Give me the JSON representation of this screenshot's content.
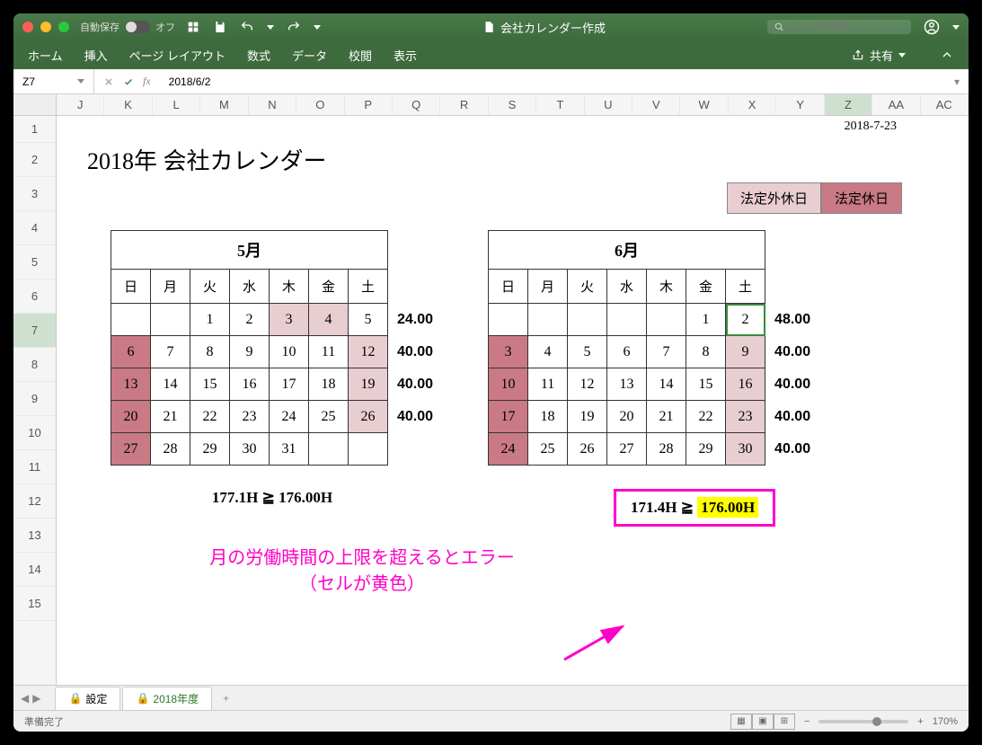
{
  "titlebar": {
    "autosave_label": "自動保存",
    "autosave_state": "オフ",
    "doc_title": "会社カレンダー作成",
    "search_placeholder": "シートを検索"
  },
  "ribbon": {
    "tabs": [
      "ホーム",
      "挿入",
      "ページ レイアウト",
      "数式",
      "データ",
      "校閲",
      "表示"
    ],
    "share": "共有"
  },
  "formula_bar": {
    "cell_ref": "Z7",
    "formula": "2018/6/2"
  },
  "columns": [
    "J",
    "K",
    "L",
    "M",
    "N",
    "O",
    "P",
    "Q",
    "R",
    "S",
    "T",
    "U",
    "V",
    "W",
    "X",
    "Y",
    "Z",
    "AA",
    "AC"
  ],
  "active_col": "Z",
  "rows": [
    1,
    2,
    3,
    4,
    5,
    6,
    7,
    8,
    9,
    10,
    11,
    12,
    13,
    14,
    15
  ],
  "active_row": 7,
  "sheet": {
    "date": "2018-7-23",
    "title": "2018年 会社カレンダー",
    "legend": {
      "a": "法定外休日",
      "b": "法定休日"
    },
    "calendars": [
      {
        "month": "5月",
        "dow": [
          "日",
          "月",
          "火",
          "水",
          "木",
          "金",
          "土"
        ],
        "weeks": [
          {
            "days": [
              {},
              {},
              {
                "n": 1
              },
              {
                "n": 2
              },
              {
                "n": 3,
                "cls": "hol-a"
              },
              {
                "n": 4,
                "cls": "hol-a"
              },
              {
                "n": 5
              }
            ],
            "h": "24.00"
          },
          {
            "days": [
              {
                "n": 6,
                "cls": "hol-b"
              },
              {
                "n": 7
              },
              {
                "n": 8
              },
              {
                "n": 9
              },
              {
                "n": 10
              },
              {
                "n": 11
              },
              {
                "n": 12,
                "cls": "hol-a"
              }
            ],
            "h": "40.00"
          },
          {
            "days": [
              {
                "n": 13,
                "cls": "hol-b"
              },
              {
                "n": 14
              },
              {
                "n": 15
              },
              {
                "n": 16
              },
              {
                "n": 17
              },
              {
                "n": 18
              },
              {
                "n": 19,
                "cls": "hol-a"
              }
            ],
            "h": "40.00"
          },
          {
            "days": [
              {
                "n": 20,
                "cls": "hol-b"
              },
              {
                "n": 21
              },
              {
                "n": 22
              },
              {
                "n": 23
              },
              {
                "n": 24
              },
              {
                "n": 25
              },
              {
                "n": 26,
                "cls": "hol-a"
              }
            ],
            "h": "40.00"
          },
          {
            "days": [
              {
                "n": 27,
                "cls": "hol-b"
              },
              {
                "n": 28
              },
              {
                "n": 29
              },
              {
                "n": 30
              },
              {
                "n": 31
              },
              {},
              {}
            ],
            "h": ""
          }
        ],
        "total": "177.1H ≧ 176.00H",
        "err": false
      },
      {
        "month": "6月",
        "dow": [
          "日",
          "月",
          "火",
          "水",
          "木",
          "金",
          "土"
        ],
        "weeks": [
          {
            "days": [
              {},
              {},
              {},
              {},
              {},
              {
                "n": 1
              },
              {
                "n": 2,
                "sel": true
              }
            ],
            "h": "48.00"
          },
          {
            "days": [
              {
                "n": 3,
                "cls": "hol-b"
              },
              {
                "n": 4
              },
              {
                "n": 5
              },
              {
                "n": 6
              },
              {
                "n": 7
              },
              {
                "n": 8
              },
              {
                "n": 9,
                "cls": "hol-a"
              }
            ],
            "h": "40.00"
          },
          {
            "days": [
              {
                "n": 10,
                "cls": "hol-b"
              },
              {
                "n": 11
              },
              {
                "n": 12
              },
              {
                "n": 13
              },
              {
                "n": 14
              },
              {
                "n": 15
              },
              {
                "n": 16,
                "cls": "hol-a"
              }
            ],
            "h": "40.00"
          },
          {
            "days": [
              {
                "n": 17,
                "cls": "hol-b"
              },
              {
                "n": 18
              },
              {
                "n": 19
              },
              {
                "n": 20
              },
              {
                "n": 21
              },
              {
                "n": 22
              },
              {
                "n": 23,
                "cls": "hol-a"
              }
            ],
            "h": "40.00"
          },
          {
            "days": [
              {
                "n": 24,
                "cls": "hol-b"
              },
              {
                "n": 25
              },
              {
                "n": 26
              },
              {
                "n": 27
              },
              {
                "n": 28
              },
              {
                "n": 29
              },
              {
                "n": 30,
                "cls": "hol-a"
              }
            ],
            "h": "40.00"
          }
        ],
        "total_left": "171.4H ≧ ",
        "total_right": "176.00H",
        "err": true
      }
    ],
    "annotation_l1": "月の労働時間の上限を超えるとエラー",
    "annotation_l2": "（セルが黄色）"
  },
  "tabs": {
    "items": [
      {
        "label": "設定",
        "active": false,
        "lock": true
      },
      {
        "label": "2018年度",
        "active": true,
        "lock": true
      }
    ]
  },
  "status": {
    "left": "準備完了",
    "zoom": "170%"
  }
}
